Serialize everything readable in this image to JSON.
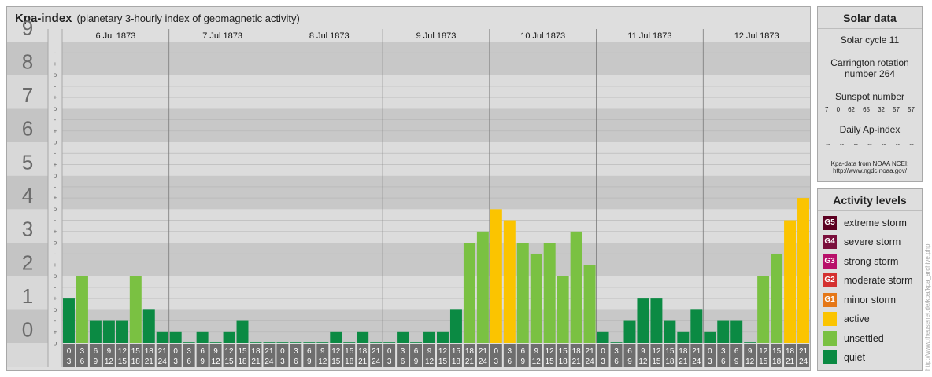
{
  "header": {
    "title": "Kpa-index",
    "subtitle": "(planetary 3-hourly index of geomagnetic activity)"
  },
  "solar": {
    "title": "Solar data",
    "cycle": "Solar cycle 11",
    "carrington_line1": "Carrington rotation",
    "carrington_line2": "number 264",
    "sunspot_title": "Sunspot number",
    "sunspot_values": [
      "7",
      "0",
      "62",
      "65",
      "32",
      "57",
      "57"
    ],
    "ap_title": "Daily Ap-index",
    "ap_values": [
      "--",
      "--",
      "--",
      "--",
      "--",
      "--",
      "--"
    ],
    "source_line1": "Kpa-data from NOAA NCEI:",
    "source_line2": "http://www.ngdc.noaa.gov/"
  },
  "levels": {
    "title": "Activity levels",
    "items": [
      {
        "code": "G5",
        "label": "extreme storm",
        "color": "#5c0021"
      },
      {
        "code": "G4",
        "label": "severe storm",
        "color": "#7a0f3c"
      },
      {
        "code": "G3",
        "label": "strong storm",
        "color": "#b8106a"
      },
      {
        "code": "G2",
        "label": "moderate storm",
        "color": "#d4302f"
      },
      {
        "code": "G1",
        "label": "minor storm",
        "color": "#e57717"
      },
      {
        "code": "",
        "label": "active",
        "color": "#fbc400"
      },
      {
        "code": "",
        "label": "unsettled",
        "color": "#7ac142"
      },
      {
        "code": "",
        "label": "quiet",
        "color": "#0b8a43"
      }
    ]
  },
  "credit": "http://www.theusenet.de/kpa/kpa_archive.php",
  "colors": {
    "quiet": "#0b8a43",
    "unsettled": "#7ac142",
    "active": "#fbc400",
    "band_dark": "#c8c8c8",
    "band_light": "#dcdcdc",
    "ylabel_band_dark": "#c4c4c4",
    "ylabel_band_light": "#d8d8d8",
    "hour_box": "#6e6e6e"
  },
  "chart_data": {
    "type": "bar",
    "title": "Kpa-index",
    "ylim": [
      0,
      9
    ],
    "y_ticks": [
      "0",
      "1",
      "2",
      "3",
      "4",
      "5",
      "6",
      "7",
      "8",
      "9"
    ],
    "sub_tick_labels": [
      "o",
      "+",
      "-"
    ],
    "days": [
      "6 Jul 1873",
      "7 Jul 1873",
      "8 Jul 1873",
      "9 Jul 1873",
      "10 Jul 1873",
      "11 Jul 1873",
      "12 Jul 1873"
    ],
    "hour_starts": [
      "0",
      "3",
      "6",
      "9",
      "12",
      "15",
      "18",
      "21"
    ],
    "hour_ends": [
      "3",
      "6",
      "9",
      "12",
      "15",
      "18",
      "21",
      "24"
    ],
    "series": [
      {
        "values": [
          1.333,
          2.0,
          0.667,
          0.667,
          0.667,
          2.0,
          1.0,
          0.333,
          0.333,
          0.0,
          0.333,
          0.0,
          0.333,
          0.667,
          0.0,
          0.0,
          0.0,
          0.0,
          0.0,
          0.0,
          0.333,
          0.0,
          0.333,
          0.0,
          0.0,
          0.333,
          0.0,
          0.333,
          0.333,
          1.0,
          3.0,
          3.333,
          4.0,
          3.667,
          3.0,
          2.667,
          3.0,
          2.0,
          3.333,
          2.333,
          0.333,
          0.0,
          0.667,
          1.333,
          1.333,
          0.667,
          0.333,
          1.0,
          0.333,
          0.667,
          0.667,
          0.0,
          2.0,
          2.667,
          3.667,
          4.333
        ]
      }
    ]
  }
}
